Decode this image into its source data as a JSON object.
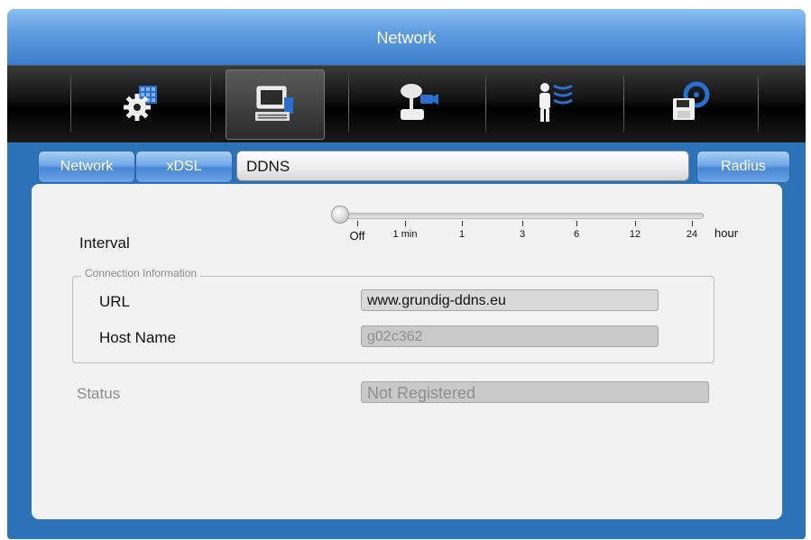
{
  "window": {
    "title": "Network"
  },
  "toolbar": {
    "items": [
      {
        "name": "system-settings",
        "icon": "gear-grid-icon",
        "active": false
      },
      {
        "name": "network",
        "icon": "computer-network-icon",
        "active": true
      },
      {
        "name": "devices",
        "icon": "joystick-camera-icon",
        "active": false
      },
      {
        "name": "events",
        "icon": "person-signal-icon",
        "active": false
      },
      {
        "name": "storage",
        "icon": "disk-save-icon",
        "active": false
      }
    ]
  },
  "tabs": {
    "network": "Network",
    "xdsl": "xDSL",
    "ddns": "DDNS",
    "radius": "Radius"
  },
  "form": {
    "interval_label": "Interval",
    "interval_value": "Off",
    "interval_ticks": [
      "Off",
      "1 min",
      "1",
      "3",
      "6",
      "12",
      "24"
    ],
    "interval_unit": "hour",
    "connection_legend": "Connection Information",
    "url_label": "URL",
    "url_value": "www.grundig-ddns.eu",
    "host_label": "Host Name",
    "host_value": "g02c362",
    "status_label": "Status",
    "status_value": "Not Registered"
  },
  "colors": {
    "window_blue": "#2c72b6",
    "tab_blue": "#6ea7e6",
    "panel": "#f2f2f2"
  }
}
